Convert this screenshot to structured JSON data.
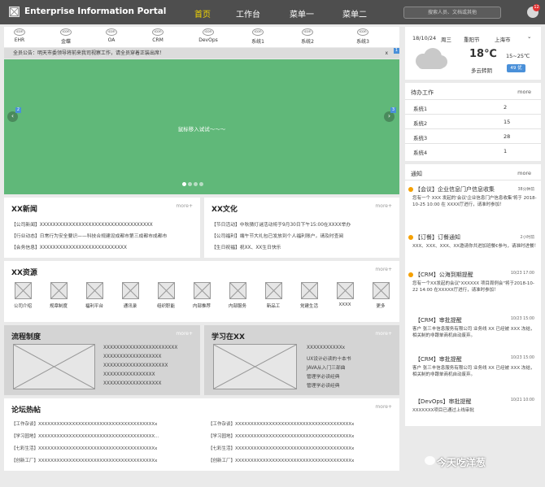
{
  "header": {
    "brand": "Enterprise Information Portal",
    "nav": [
      "首页",
      "工作台",
      "菜单一",
      "菜单二"
    ],
    "search_placeholder": "搜索人员、文档或其他",
    "badge": "12"
  },
  "apps": [
    {
      "icon": "icon",
      "label": "EHR"
    },
    {
      "icon": "icon",
      "label": "金蝶"
    },
    {
      "icon": "icon",
      "label": "OA"
    },
    {
      "icon": "icon",
      "label": "CRM"
    },
    {
      "icon": "icon",
      "label": "DevOps"
    },
    {
      "icon": "icon",
      "label": "系统1"
    },
    {
      "icon": "icon",
      "label": "系统2"
    },
    {
      "icon": "icon",
      "label": "系统3"
    }
  ],
  "notice": {
    "text": "全员公告：明天市委领导将前来我司视察工作，请全员穿着正装出席！",
    "close": "x",
    "num": "1"
  },
  "banner": {
    "text": "鼠标移入试试～～～",
    "prev": "‹",
    "next": "›",
    "left_num": "2",
    "right_num": "3",
    "slide": 1,
    "slide_count": 4
  },
  "news": {
    "title": "XX新闻",
    "more": "more+",
    "items": [
      "【公司新闻】XXXXXXXXXXXXXXXXXXXXXXXXXXXXXXXXXXX",
      "【行业动态】日常行为安全要识——科技合规建设成都市第三成都市成都市",
      "【会务信息】XXXXXXXXXXXXXXXXXXXXXXXXXXX"
    ]
  },
  "culture": {
    "title": "XX文化",
    "more": "more+",
    "items": [
      "【节日活动】中秋猜灯谜活动将于9月30日下午15:00在XXXX举办",
      "【公司福利】端午节大礼包已发放到个人福利账户，请及时查阅",
      "【生日祝福】祝XX、XX生日快乐"
    ]
  },
  "resources": {
    "title": "XX资源",
    "more": "more+",
    "items": [
      "公司介绍",
      "规章制度",
      "福利平台",
      "通讯录",
      "组织职能",
      "内部推荐",
      "内部服务",
      "新品工",
      "党建生活",
      "XXXX",
      "更多"
    ]
  },
  "process": {
    "title": "流程制度",
    "more": "more+",
    "lines": [
      "XXXXXXXXXXXXXXXXXXXXXXX",
      "XXXXXXXXXXXXXXXXXX",
      "XXXXXXXXXXXXXXXXXXXX",
      "XXXXXXXXXXXXXXXX",
      "XXXXXXXXXXXXXXXXXX"
    ]
  },
  "learn": {
    "title": "学习在XX",
    "more": "more+",
    "lines": [
      "XXXXXXXXXXXx",
      "UX设计必读的十本书",
      "JAVA从入门三部曲",
      "管理学必读经典",
      "管理学必读经典"
    ]
  },
  "forum": {
    "title": "论坛热帖",
    "more": "more+",
    "left": [
      "【工作杂谈】XXXXXXXXXXXXXXXXXXXXXXXXXXXXXXXXXXXXXXx",
      "【学习园地】XXXXXXXXXXXXXXXXXXXXXXXXXXXXXXXXXXXXXX...",
      "【七彩生活】XXXXXXXXXXXXXXXXXXXXXXXXXXXXXXXXXXXXXXx",
      "【创新工厂】XXXXXXXXXXXXXXXXXXXXXXXXXXXXXXXXXXXXXXx"
    ],
    "right": [
      "【工作杂谈】XXXXXXXXXXXXXXXXXXXXXXXXXXXXXXXXXXXXXXx",
      "【学习园地】XXXXXXXXXXXXXXXXXXXXXXXXXXXXXXXXXXXXXXx",
      "【七彩生活】XXXXXXXXXXXXXXXXXXXXXXXXXXXXXXXXXXXXXXx",
      "【创新工厂】XXXXXXXXXXXXXXXXXXXXXXXXXXXXXXXXXXXXXXx"
    ]
  },
  "weather": {
    "date": "18/10/24",
    "weekday": "周三",
    "festival": "重阳节",
    "city": "上海市",
    "chevron": "⌄",
    "temp": "18℃",
    "range": "15~25℃",
    "desc": "多云转阴",
    "aqi": "49 优"
  },
  "todo": {
    "title": "待办工作",
    "more": "more",
    "rows": [
      {
        "name": "系统1",
        "count": "2"
      },
      {
        "name": "系统2",
        "count": "15"
      },
      {
        "name": "系统3",
        "count": "28"
      },
      {
        "name": "系统4",
        "count": "1"
      }
    ]
  },
  "notify": {
    "title": "通知",
    "more": "more",
    "items": [
      {
        "title": "【会议】企业信息门户信息收集",
        "time": "38分钟前",
        "body": "您有一个 XXX 发起的'会议'企业信息门户信息收集'将于 2018-10-25 10:00 在 XXXX厅进行，请准时参加！",
        "dot": true
      },
      {
        "title": "【订餐】订餐通知",
        "time": "2小时前",
        "body": "XXX、XXX、XXX、XX邀请你共进加班餐€参与，请准时进餐！",
        "dot": true
      },
      {
        "title": "【CRM】公海到期提醒",
        "time": "10/23 17:00",
        "body": "您有一个XX发起的会议\"XXXXXX 项目周例会\"将于2018-10-22 14:00 在XXXXX厅进行，请准时参加！",
        "dot": true
      },
      {
        "title": "【CRM】审批提醒",
        "time": "10/23 15:00",
        "body": "客户 张三丰信息服务有限公司 业务线 XX 已经被 XXX 冻结，相关制的非跟单商机自动废弃。",
        "dot": false
      },
      {
        "title": "【CRM】审批提醒",
        "time": "10/23 15:00",
        "body": "客户 张三丰信息服务有限公司 业务线 XX 已经被 XXX 冻结，相关制的非跟单商机自动废弃。",
        "dot": false
      },
      {
        "title": "【DevOps】审批提醒",
        "time": "10/21 10:00",
        "body": "XXXXXXX项目已通过上线审批",
        "dot": false
      }
    ]
  },
  "watermark": "今天吃洋葱"
}
